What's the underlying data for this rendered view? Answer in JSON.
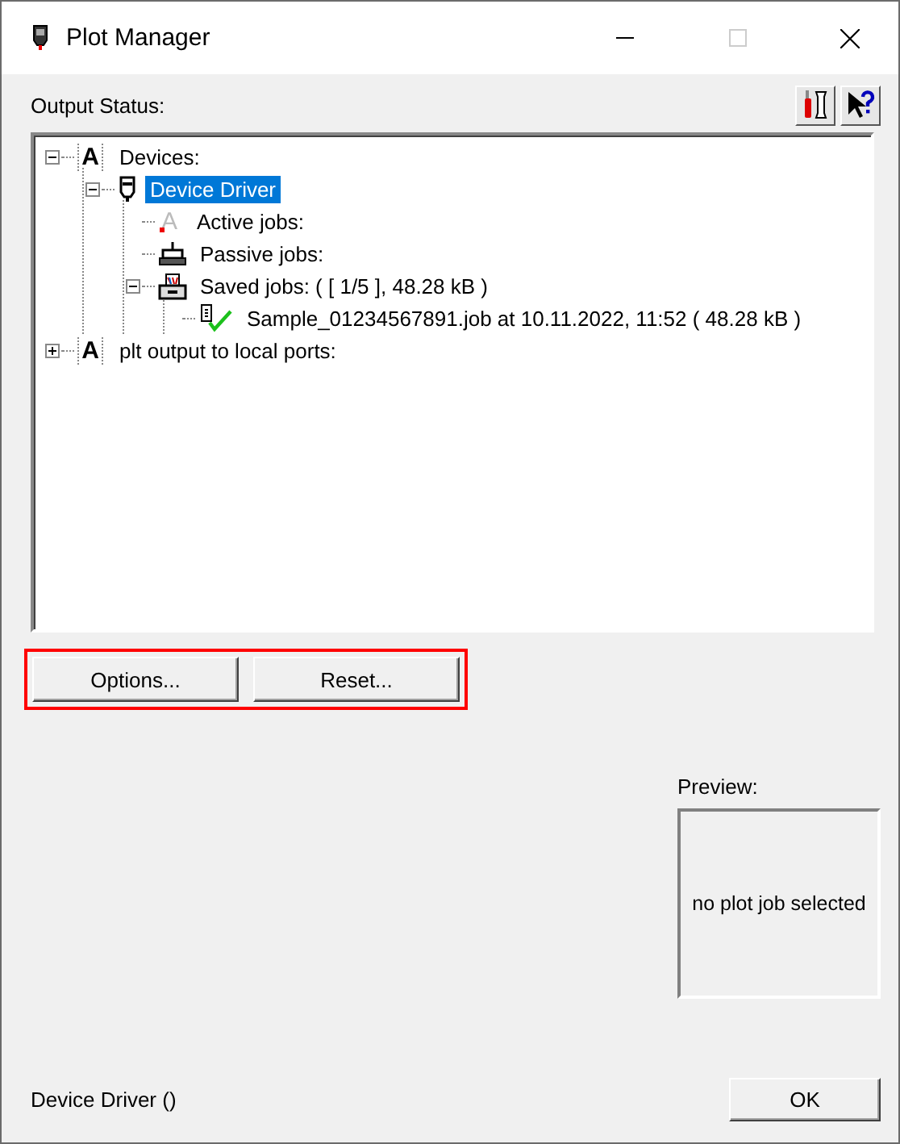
{
  "window": {
    "title": "Plot Manager",
    "maximize_disabled": true
  },
  "output_status": {
    "label": "Output Status:"
  },
  "tree": [
    {
      "label": "Devices:",
      "kind": "letter",
      "glyph": "A",
      "expanded": true,
      "selected": false,
      "children": [
        {
          "label": "Device Driver",
          "kind": "plotter",
          "expanded": true,
          "selected": true,
          "children": [
            {
              "label": "Active jobs:",
              "kind": "faded-letter",
              "glyph": "A",
              "selected": false
            },
            {
              "label": "Passive jobs:",
              "kind": "passive",
              "selected": false
            },
            {
              "label": "Saved jobs: ( [ 1/5 ], 48.28 kB )",
              "kind": "saved",
              "expanded": true,
              "selected": false,
              "children": [
                {
                  "label": "Sample_01234567891.job at 10.11.2022, 11:52 ( 48.28 kB )",
                  "kind": "job",
                  "selected": false
                }
              ]
            }
          ]
        }
      ]
    },
    {
      "label": "plt output to local ports:",
      "kind": "letter",
      "glyph": "A",
      "expanded": false,
      "selected": false
    }
  ],
  "buttons": [
    {
      "label": "Options..."
    },
    {
      "label": "Reset..."
    }
  ],
  "highlight": true,
  "preview": {
    "label": "Preview:",
    "message": "no plot job selected"
  },
  "status": "Device Driver ()",
  "ok_button": "OK"
}
